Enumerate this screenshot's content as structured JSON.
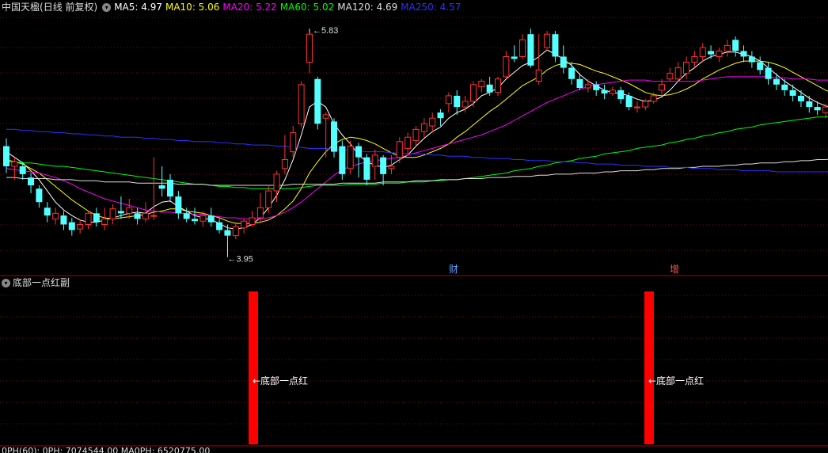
{
  "header": {
    "stock_name": "中国天楹",
    "period": "(日线 前复权)",
    "ma_labels": [
      {
        "label": "MA5: 4.97",
        "color": "#ffffff"
      },
      {
        "label": "MA10: 5.06",
        "color": "#ffff00"
      },
      {
        "label": "MA20: 5.22",
        "color": "#ff00ff"
      },
      {
        "label": "MA60: 5.02",
        "color": "#00ff00"
      },
      {
        "label": "MA120: 4.69",
        "color": "#dddddd"
      },
      {
        "label": "MA250: 4.57",
        "color": "#3030ff"
      }
    ]
  },
  "colors": {
    "up": "#ff3232",
    "down": "#54ffff",
    "signal": "#ff0000",
    "grid": "#8b0000"
  },
  "indicator": {
    "title": "底部一点红副",
    "signal_label": "←底部一点红"
  },
  "bottom_row": {
    "text": "0PH(60): 0PH: 7074544.00 MA0PH: 6520775.00"
  },
  "chart_data": {
    "type": "candlestick",
    "price_range": [
      3.7,
      5.95
    ],
    "high_label": "5.83",
    "low_label": "3.95",
    "event_markers": [
      "财",
      "增"
    ],
    "candles": [
      [
        4.8,
        4.62,
        4.87,
        4.56
      ],
      [
        4.62,
        4.66,
        4.7,
        4.5
      ],
      [
        4.62,
        4.55,
        4.66,
        4.5
      ],
      [
        4.52,
        4.45,
        4.56,
        4.38
      ],
      [
        4.42,
        4.3,
        4.45,
        4.25
      ],
      [
        4.25,
        4.18,
        4.3,
        4.12
      ],
      [
        4.15,
        4.2,
        4.25,
        4.1
      ],
      [
        4.18,
        4.1,
        4.22,
        4.05
      ],
      [
        4.12,
        4.05,
        4.16,
        4.0
      ],
      [
        4.06,
        4.1,
        4.14,
        4.02
      ],
      [
        4.1,
        4.2,
        4.22,
        4.06
      ],
      [
        4.2,
        4.12,
        4.25,
        4.08
      ],
      [
        4.1,
        4.15,
        4.25,
        4.05
      ],
      [
        4.15,
        4.24,
        4.28,
        4.1
      ],
      [
        4.22,
        4.2,
        4.35,
        4.15
      ],
      [
        4.2,
        4.25,
        4.33,
        4.15
      ],
      [
        4.2,
        4.15,
        4.25,
        4.1
      ],
      [
        4.15,
        4.2,
        4.3,
        4.12
      ],
      [
        4.18,
        4.18,
        4.7,
        4.14
      ],
      [
        4.45,
        4.42,
        4.62,
        4.35
      ],
      [
        4.5,
        4.35,
        4.55,
        4.3
      ],
      [
        4.35,
        4.2,
        4.4,
        4.15
      ],
      [
        4.2,
        4.15,
        4.25,
        4.12
      ],
      [
        4.15,
        4.13,
        4.25,
        4.1
      ],
      [
        4.13,
        4.18,
        4.22,
        4.08
      ],
      [
        4.18,
        4.12,
        4.25,
        4.08
      ],
      [
        4.12,
        4.05,
        4.15,
        4.02
      ],
      [
        4.05,
        4.0,
        4.1,
        3.95
      ],
      [
        4.0,
        4.08,
        4.12,
        3.97
      ],
      [
        4.07,
        4.13,
        4.15,
        4.02
      ],
      [
        4.1,
        4.16,
        4.22,
        4.08
      ],
      [
        4.16,
        4.25,
        4.38,
        4.12
      ],
      [
        4.25,
        4.4,
        4.45,
        4.2
      ],
      [
        4.4,
        4.55,
        4.58,
        4.3
      ],
      [
        4.6,
        4.68,
        4.9,
        4.55
      ],
      [
        4.75,
        4.92,
        4.98,
        4.7
      ],
      [
        5.0,
        5.35,
        5.38,
        4.97
      ],
      [
        5.55,
        5.8,
        5.85,
        5.45
      ],
      [
        5.4,
        5.0,
        5.42,
        4.95
      ],
      [
        5.05,
        5.08,
        5.1,
        4.7
      ],
      [
        5.02,
        4.75,
        5.05,
        4.7
      ],
      [
        4.8,
        4.55,
        4.85,
        4.5
      ],
      [
        4.6,
        4.8,
        4.85,
        4.55
      ],
      [
        4.8,
        4.7,
        4.83,
        4.52
      ],
      [
        4.7,
        4.5,
        4.73,
        4.45
      ],
      [
        4.62,
        4.72,
        4.77,
        4.5
      ],
      [
        4.7,
        4.55,
        4.72,
        4.45
      ],
      [
        4.6,
        4.62,
        4.72,
        4.55
      ],
      [
        4.7,
        4.84,
        4.88,
        4.65
      ],
      [
        4.78,
        4.88,
        4.92,
        4.72
      ],
      [
        4.85,
        4.95,
        4.98,
        4.8
      ],
      [
        4.93,
        5.0,
        5.05,
        4.88
      ],
      [
        4.98,
        5.05,
        5.1,
        4.92
      ],
      [
        5.1,
        5.05,
        5.13,
        4.98
      ],
      [
        5.18,
        5.25,
        5.28,
        5.1
      ],
      [
        5.25,
        5.15,
        5.3,
        5.08
      ],
      [
        5.15,
        5.2,
        5.25,
        5.1
      ],
      [
        5.2,
        5.35,
        5.38,
        5.15
      ],
      [
        5.33,
        5.38,
        5.4,
        5.28
      ],
      [
        5.35,
        5.28,
        5.42,
        5.25
      ],
      [
        5.28,
        5.4,
        5.42,
        5.25
      ],
      [
        5.42,
        5.6,
        5.65,
        5.4
      ],
      [
        5.6,
        5.58,
        5.7,
        5.55
      ],
      [
        5.6,
        5.75,
        5.8,
        5.58
      ],
      [
        5.8,
        5.52,
        5.85,
        5.5
      ],
      [
        5.38,
        5.48,
        5.8,
        5.35
      ],
      [
        5.68,
        5.8,
        5.83,
        5.65
      ],
      [
        5.8,
        5.6,
        5.83,
        5.55
      ],
      [
        5.6,
        5.5,
        5.7,
        5.45
      ],
      [
        5.5,
        5.4,
        5.55,
        5.35
      ],
      [
        5.4,
        5.32,
        5.45,
        5.3
      ],
      [
        5.32,
        5.35,
        5.4,
        5.28
      ],
      [
        5.35,
        5.3,
        5.38,
        5.25
      ],
      [
        5.3,
        5.27,
        5.35,
        5.22
      ],
      [
        5.27,
        5.3,
        5.33,
        5.25
      ],
      [
        5.3,
        5.22,
        5.33,
        5.18
      ],
      [
        5.25,
        5.15,
        5.28,
        5.12
      ],
      [
        5.15,
        5.15,
        5.2,
        5.1
      ],
      [
        5.15,
        5.2,
        5.22,
        5.12
      ],
      [
        5.2,
        5.25,
        5.28,
        5.18
      ],
      [
        5.3,
        5.35,
        5.4,
        5.25
      ],
      [
        5.4,
        5.45,
        5.5,
        5.38
      ],
      [
        5.4,
        5.5,
        5.55,
        5.38
      ],
      [
        5.45,
        5.55,
        5.6,
        5.4
      ],
      [
        5.55,
        5.6,
        5.65,
        5.5
      ],
      [
        5.6,
        5.68,
        5.72,
        5.55
      ],
      [
        5.65,
        5.62,
        5.7,
        5.58
      ],
      [
        5.6,
        5.65,
        5.68,
        5.55
      ],
      [
        5.65,
        5.7,
        5.75,
        5.6
      ],
      [
        5.75,
        5.65,
        5.78,
        5.6
      ],
      [
        5.65,
        5.6,
        5.7,
        5.55
      ],
      [
        5.6,
        5.55,
        5.65,
        5.5
      ],
      [
        5.55,
        5.48,
        5.6,
        5.44
      ],
      [
        5.5,
        5.4,
        5.55,
        5.35
      ],
      [
        5.4,
        5.35,
        5.45,
        5.3
      ],
      [
        5.35,
        5.3,
        5.4,
        5.25
      ],
      [
        5.3,
        5.25,
        5.35,
        5.2
      ],
      [
        5.25,
        5.2,
        5.3,
        5.15
      ],
      [
        5.2,
        5.15,
        5.25,
        5.1
      ],
      [
        5.15,
        5.12,
        5.2,
        5.08
      ],
      [
        5.1,
        5.15,
        5.18,
        5.05
      ],
      [
        5.15,
        5.1,
        5.2,
        5.05
      ]
    ],
    "series": [
      {
        "name": "MA5",
        "color": "#ffffff",
        "values": [
          4.75,
          4.7,
          4.65,
          4.58,
          4.5,
          4.4,
          4.3,
          4.23,
          4.18,
          4.14,
          4.12,
          4.12,
          4.14,
          4.16,
          4.18,
          4.2,
          4.21,
          4.2,
          4.26,
          4.3,
          4.31,
          4.26,
          4.22,
          4.18,
          4.16,
          4.14,
          4.11,
          4.07,
          4.06,
          4.07,
          4.1,
          4.16,
          4.25,
          4.36,
          4.5,
          4.68,
          4.9,
          5.15,
          5.2,
          5.15,
          5.0,
          4.9,
          4.82,
          4.72,
          4.66,
          4.63,
          4.61,
          4.63,
          4.68,
          4.72,
          4.8,
          4.87,
          4.93,
          4.97,
          5.05,
          5.1,
          5.13,
          5.18,
          5.25,
          5.28,
          5.32,
          5.4,
          5.46,
          5.52,
          5.55,
          5.6,
          5.66,
          5.62,
          5.58,
          5.52,
          5.44,
          5.38,
          5.34,
          5.3,
          5.28,
          5.27,
          5.25,
          5.22,
          5.2,
          5.21,
          5.24,
          5.3,
          5.38,
          5.45,
          5.5,
          5.56,
          5.6,
          5.62,
          5.64,
          5.64,
          5.62,
          5.6,
          5.56,
          5.5,
          5.44,
          5.38,
          5.33,
          5.28,
          5.23,
          5.19,
          5.16,
          5.14
        ]
      },
      {
        "name": "MA10",
        "color": "#ffff00",
        "values": [
          4.68,
          4.66,
          4.64,
          4.6,
          4.56,
          4.5,
          4.44,
          4.38,
          4.32,
          4.27,
          4.22,
          4.18,
          4.16,
          4.15,
          4.16,
          4.17,
          4.18,
          4.19,
          4.21,
          4.22,
          4.24,
          4.24,
          4.22,
          4.21,
          4.2,
          4.18,
          4.16,
          4.13,
          4.11,
          4.11,
          4.11,
          4.12,
          4.14,
          4.18,
          4.24,
          4.31,
          4.42,
          4.56,
          4.66,
          4.75,
          4.82,
          4.86,
          4.88,
          4.87,
          4.85,
          4.82,
          4.78,
          4.74,
          4.71,
          4.7,
          4.7,
          4.72,
          4.75,
          4.78,
          4.82,
          4.88,
          4.93,
          4.99,
          5.05,
          5.11,
          5.16,
          5.22,
          5.28,
          5.34,
          5.38,
          5.42,
          5.48,
          5.52,
          5.54,
          5.54,
          5.53,
          5.5,
          5.47,
          5.45,
          5.42,
          5.39,
          5.36,
          5.32,
          5.28,
          5.26,
          5.25,
          5.26,
          5.28,
          5.31,
          5.35,
          5.4,
          5.44,
          5.48,
          5.51,
          5.54,
          5.56,
          5.56,
          5.56,
          5.55,
          5.53,
          5.5,
          5.46,
          5.42,
          5.38,
          5.34,
          5.3,
          5.27
        ]
      },
      {
        "name": "MA20",
        "color": "#ff00ff",
        "values": [
          4.6,
          4.59,
          4.58,
          4.57,
          4.56,
          4.54,
          4.52,
          4.49,
          4.46,
          4.42,
          4.39,
          4.36,
          4.33,
          4.31,
          4.29,
          4.27,
          4.25,
          4.23,
          4.22,
          4.21,
          4.21,
          4.2,
          4.2,
          4.19,
          4.19,
          4.18,
          4.17,
          4.16,
          4.16,
          4.15,
          4.15,
          4.15,
          4.16,
          4.18,
          4.21,
          4.25,
          4.3,
          4.36,
          4.42,
          4.48,
          4.54,
          4.59,
          4.62,
          4.64,
          4.66,
          4.67,
          4.68,
          4.69,
          4.7,
          4.72,
          4.74,
          4.76,
          4.78,
          4.8,
          4.82,
          4.84,
          4.86,
          4.88,
          4.9,
          4.93,
          4.96,
          4.99,
          5.03,
          5.07,
          5.11,
          5.15,
          5.19,
          5.22,
          5.25,
          5.28,
          5.31,
          5.33,
          5.35,
          5.36,
          5.37,
          5.38,
          5.39,
          5.39,
          5.39,
          5.38,
          5.38,
          5.38,
          5.38,
          5.38,
          5.38,
          5.39,
          5.4,
          5.41,
          5.42,
          5.42,
          5.42,
          5.42,
          5.42,
          5.42,
          5.41,
          5.41,
          5.4,
          5.4,
          5.4,
          5.39,
          5.39,
          5.39
        ]
      },
      {
        "name": "MA60",
        "color": "#00ff00",
        "values": [
          4.66,
          4.66,
          4.65,
          4.65,
          4.64,
          4.63,
          4.62,
          4.62,
          4.61,
          4.6,
          4.59,
          4.58,
          4.57,
          4.56,
          4.55,
          4.54,
          4.53,
          4.52,
          4.51,
          4.5,
          4.49,
          4.48,
          4.47,
          4.46,
          4.46,
          4.45,
          4.44,
          4.44,
          4.43,
          4.43,
          4.42,
          4.42,
          4.42,
          4.42,
          4.42,
          4.42,
          4.43,
          4.44,
          4.45,
          4.45,
          4.45,
          4.45,
          4.46,
          4.46,
          4.46,
          4.46,
          4.47,
          4.47,
          4.47,
          4.48,
          4.48,
          4.48,
          4.49,
          4.49,
          4.5,
          4.5,
          4.51,
          4.52,
          4.53,
          4.54,
          4.55,
          4.56,
          4.58,
          4.59,
          4.6,
          4.62,
          4.63,
          4.65,
          4.66,
          4.67,
          4.69,
          4.7,
          4.71,
          4.73,
          4.74,
          4.75,
          4.76,
          4.78,
          4.79,
          4.8,
          4.81,
          4.83,
          4.84,
          4.86,
          4.87,
          4.89,
          4.9,
          4.92,
          4.93,
          4.95,
          4.96,
          4.97,
          4.99,
          5.0,
          5.01,
          5.02,
          5.03,
          5.04,
          5.05,
          5.06,
          5.06,
          5.07
        ]
      },
      {
        "name": "MA120",
        "color": "#dddddd",
        "values": [
          4.52,
          4.52,
          4.51,
          4.51,
          4.51,
          4.51,
          4.5,
          4.5,
          4.5,
          4.49,
          4.49,
          4.49,
          4.48,
          4.48,
          4.48,
          4.48,
          4.47,
          4.47,
          4.47,
          4.47,
          4.47,
          4.46,
          4.46,
          4.46,
          4.46,
          4.45,
          4.45,
          4.45,
          4.45,
          4.45,
          4.45,
          4.45,
          4.45,
          4.45,
          4.45,
          4.46,
          4.46,
          4.46,
          4.46,
          4.46,
          4.46,
          4.47,
          4.47,
          4.47,
          4.47,
          4.47,
          4.48,
          4.48,
          4.48,
          4.48,
          4.49,
          4.49,
          4.49,
          4.5,
          4.5,
          4.5,
          4.51,
          4.51,
          4.51,
          4.52,
          4.52,
          4.52,
          4.53,
          4.53,
          4.53,
          4.54,
          4.54,
          4.55,
          4.55,
          4.55,
          4.56,
          4.56,
          4.56,
          4.57,
          4.57,
          4.58,
          4.58,
          4.58,
          4.59,
          4.59,
          4.6,
          4.6,
          4.6,
          4.61,
          4.61,
          4.62,
          4.62,
          4.62,
          4.63,
          4.63,
          4.64,
          4.64,
          4.65,
          4.65,
          4.65,
          4.66,
          4.66,
          4.67,
          4.67,
          4.68,
          4.68,
          4.69
        ]
      },
      {
        "name": "MA250",
        "color": "#3030ff",
        "values": [
          4.95,
          4.95,
          4.94,
          4.94,
          4.93,
          4.93,
          4.92,
          4.92,
          4.91,
          4.91,
          4.9,
          4.9,
          4.89,
          4.89,
          4.88,
          4.88,
          4.88,
          4.87,
          4.87,
          4.86,
          4.86,
          4.85,
          4.85,
          4.84,
          4.84,
          4.84,
          4.83,
          4.83,
          4.82,
          4.82,
          4.81,
          4.81,
          4.81,
          4.8,
          4.8,
          4.79,
          4.79,
          4.78,
          4.78,
          4.78,
          4.77,
          4.77,
          4.76,
          4.76,
          4.75,
          4.75,
          4.75,
          4.74,
          4.74,
          4.73,
          4.73,
          4.73,
          4.72,
          4.72,
          4.71,
          4.71,
          4.71,
          4.7,
          4.7,
          4.69,
          4.69,
          4.69,
          4.68,
          4.68,
          4.67,
          4.67,
          4.67,
          4.66,
          4.66,
          4.66,
          4.65,
          4.65,
          4.64,
          4.64,
          4.64,
          4.63,
          4.63,
          4.63,
          4.62,
          4.62,
          4.62,
          4.61,
          4.61,
          4.61,
          4.6,
          4.6,
          4.6,
          4.59,
          4.59,
          4.59,
          4.58,
          4.58,
          4.58,
          4.58,
          4.57,
          4.57,
          4.57,
          4.57,
          4.57,
          4.57,
          4.57,
          4.57
        ]
      }
    ],
    "signal_bars": [
      38,
      100
    ]
  }
}
